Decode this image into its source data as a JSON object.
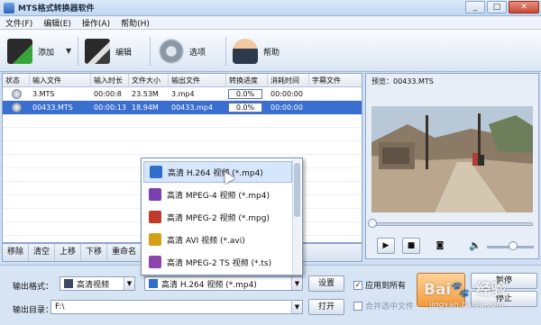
{
  "window": {
    "title": "MTS格式转换器软件",
    "minimize": "_",
    "maximize": "□",
    "close": "✕"
  },
  "menu": [
    "文件(F)",
    "编辑(E)",
    "操作(A)",
    "帮助(H)"
  ],
  "toolbar": {
    "add": "添加",
    "edit": "编辑",
    "options": "选项",
    "help": "帮助"
  },
  "table": {
    "columns": [
      "状态",
      "输入文件",
      "输入时长",
      "文件大小",
      "输出文件",
      "转换进度",
      "消耗时间",
      "字幕文件"
    ],
    "rows": [
      {
        "input": "3.MTS",
        "duration": "00:00:8",
        "size": "23.53M",
        "output": "3.mp4",
        "progress": "0.0%",
        "elapsed": "00:00:00",
        "subtitle": ""
      },
      {
        "input": "00433.MTS",
        "duration": "00:00:13",
        "size": "18.94M",
        "output": "00433.mp4",
        "progress": "0.0%",
        "elapsed": "00:00:00",
        "subtitle": ""
      }
    ]
  },
  "list_actions": [
    "移除",
    "清空",
    "上移",
    "下移",
    "重命名"
  ],
  "preview": {
    "label": "预览：00433.MTS"
  },
  "format_popup": {
    "items": [
      "高清 H.264 视频 (*.mp4)",
      "高清 MPEG-4 视频 (*.mp4)",
      "高清 MPEG-2 视频 (*.mpg)",
      "高清 AVI 视频 (*.avi)",
      "高清 MPEG-2 TS 视频 (*.ts)"
    ],
    "icon_colors": [
      "#2f6fc9",
      "#7a3fb0",
      "#c0392b",
      "#d4a017",
      "#8e44ad"
    ]
  },
  "output": {
    "format_label": "输出格式：",
    "category": "高清视频",
    "format": "高清 H.264 视频 (*.mp4)",
    "settings": "设置",
    "dir_label": "输出目录：",
    "dir": "F:\\",
    "open": "打开",
    "apply_all": "应用到所有",
    "merge": "合并选中文件"
  },
  "actions": {
    "pause": "暂停",
    "stop": "停止"
  },
  "watermark": {
    "brand": "Bai🐾 经验",
    "url": "jingyan.baidu.com"
  }
}
